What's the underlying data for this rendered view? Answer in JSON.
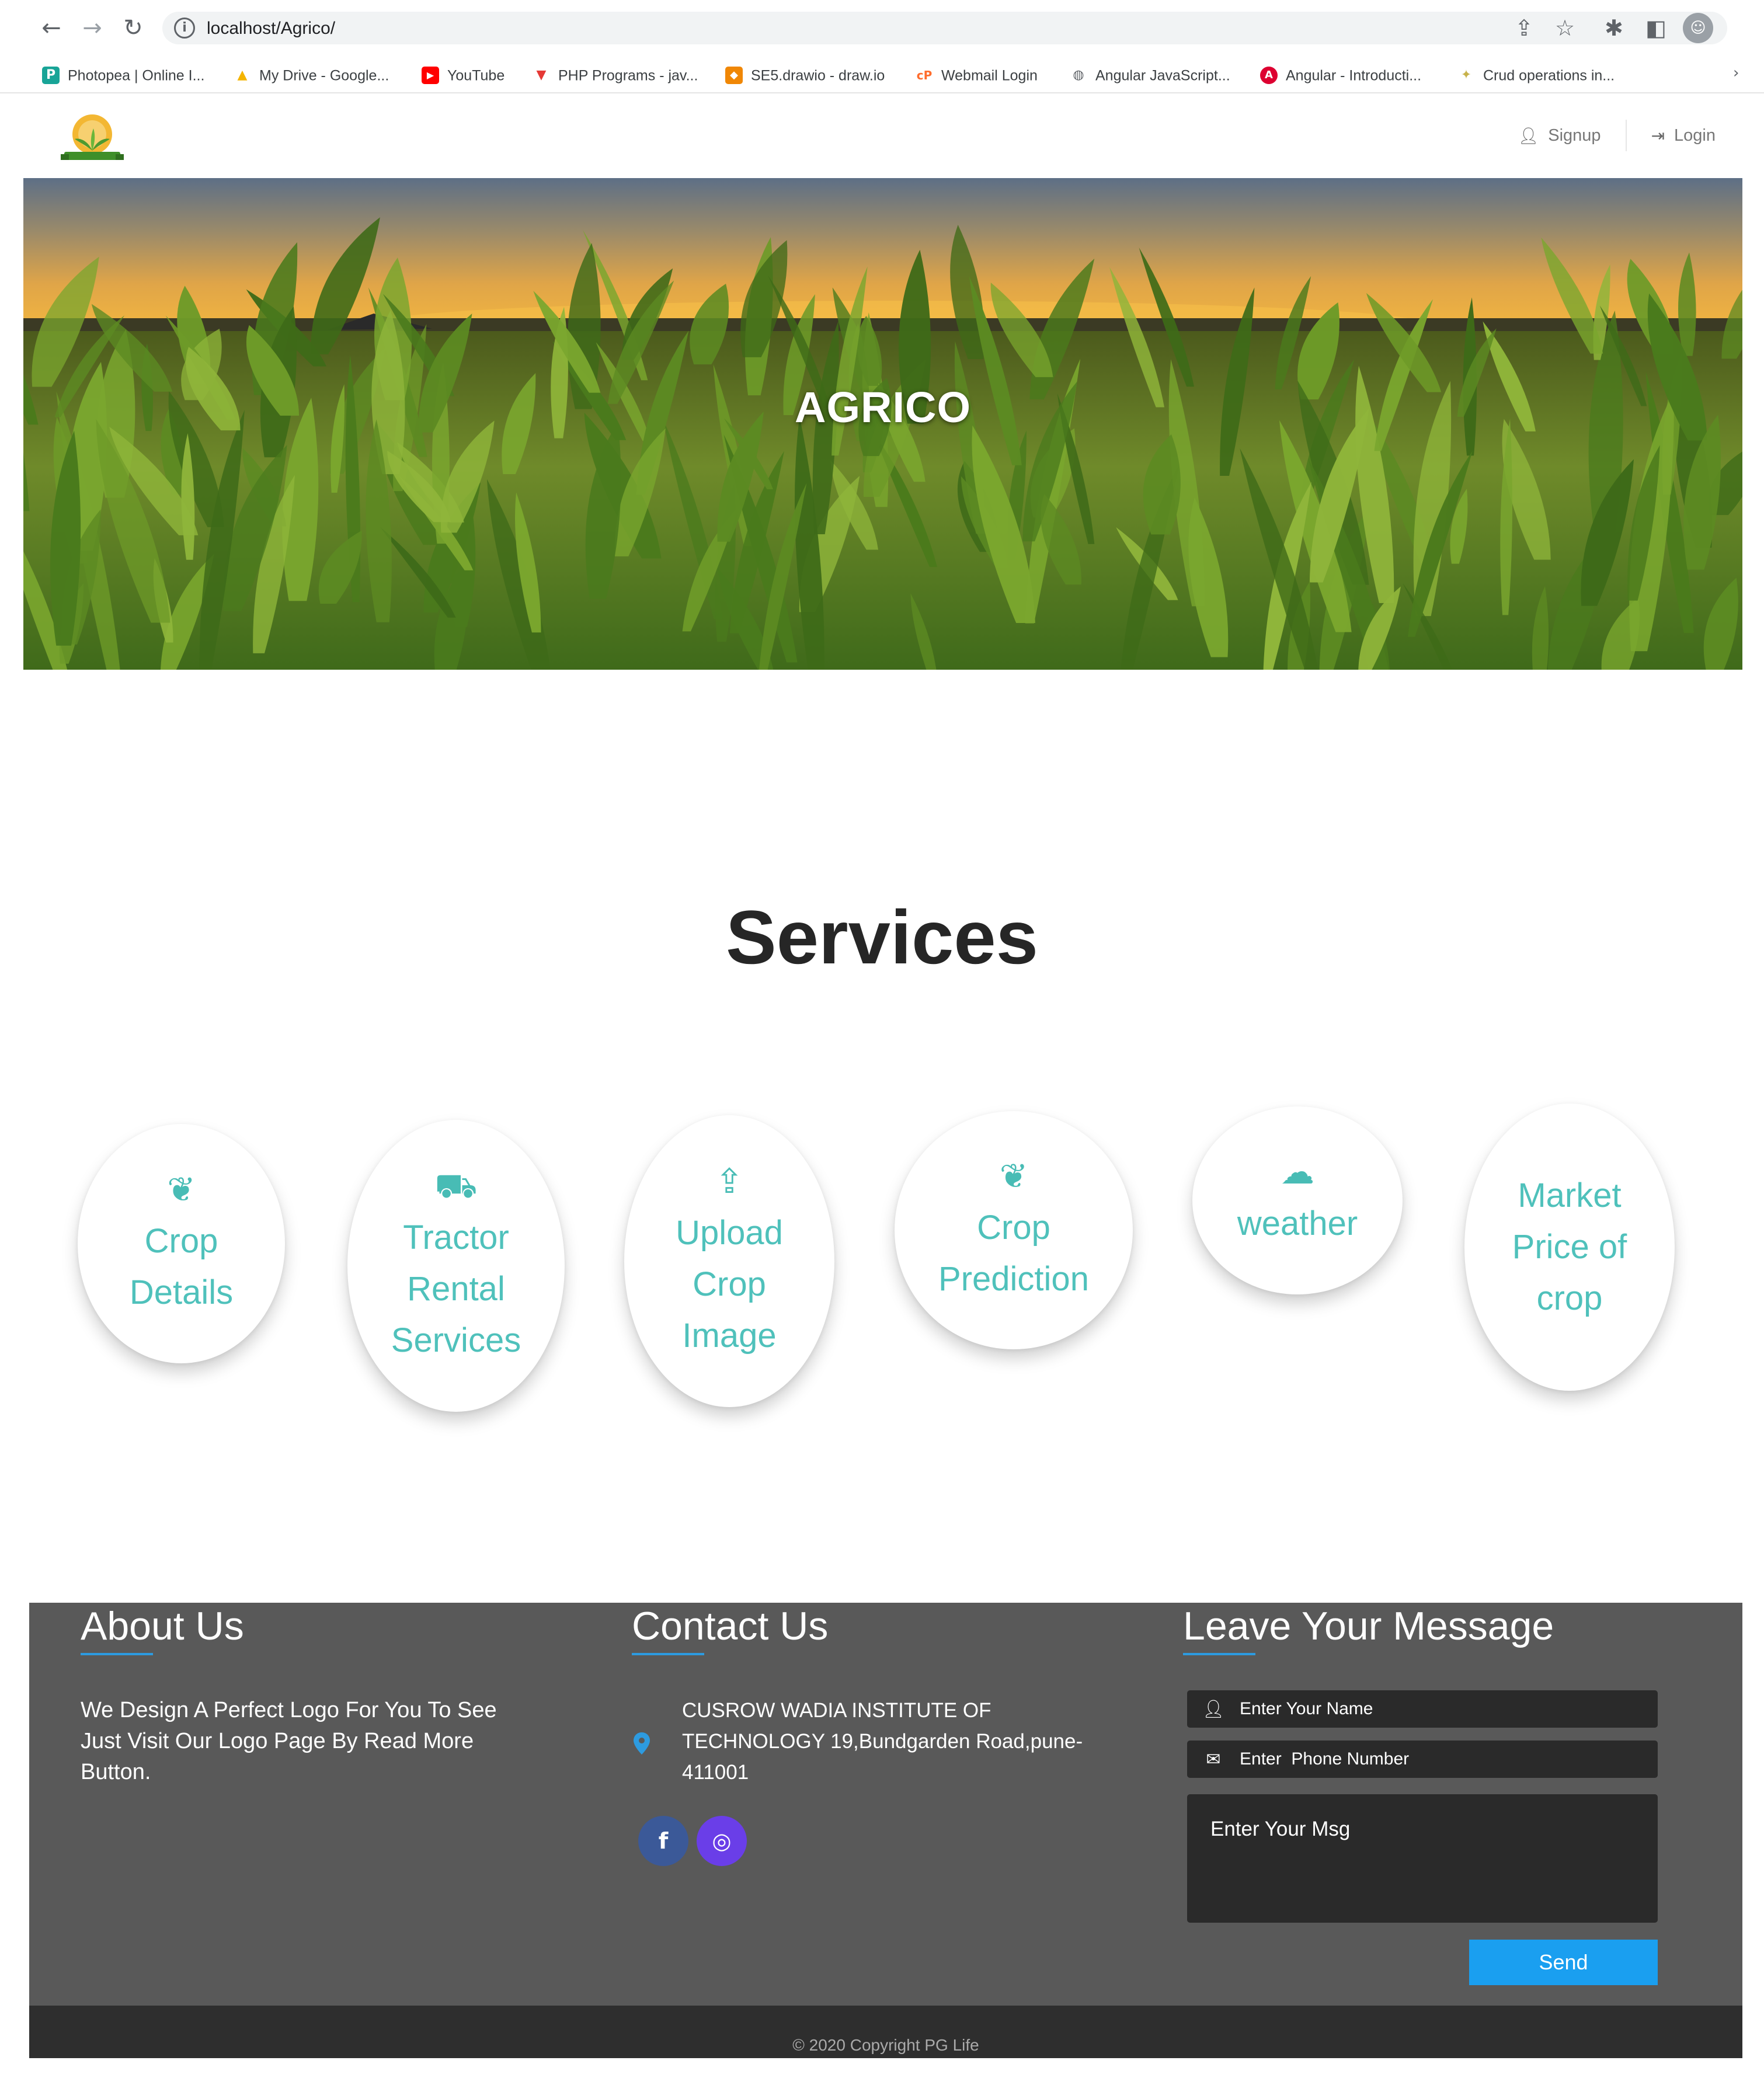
{
  "browser": {
    "url": "localhost/Agrico/",
    "bookmarks": [
      {
        "label": "Photopea | Online I...",
        "color": "#18a497",
        "glyph": "P"
      },
      {
        "label": "My Drive - Google...",
        "color": "#f4b400",
        "glyph": "▲"
      },
      {
        "label": "YouTube",
        "color": "#ff0000",
        "glyph": "▶"
      },
      {
        "label": "PHP Programs - jav...",
        "color": "#e53935",
        "glyph": "▼"
      },
      {
        "label": "SE5.drawio - draw.io",
        "color": "#f08705",
        "glyph": "◆"
      },
      {
        "label": "Webmail Login",
        "color": "#ff6c2c",
        "glyph": "cP"
      },
      {
        "label": "Angular JavaScript...",
        "color": "#5f6368",
        "glyph": "◍"
      },
      {
        "label": "Angular - Introducti...",
        "color": "#dd0031",
        "glyph": "A"
      },
      {
        "label": "Crud operations in...",
        "color": "#c7b24a",
        "glyph": "✦"
      }
    ]
  },
  "header": {
    "signup_label": "Signup",
    "login_label": "Login"
  },
  "hero": {
    "title": "AGRICO"
  },
  "services": {
    "title": "Services",
    "items": [
      {
        "label": "Crop Details",
        "icon": "sprout-icon",
        "glyph": "❦"
      },
      {
        "label": "Tractor Rental Services",
        "icon": "tractor-icon",
        "glyph": "⛟"
      },
      {
        "label": "Upload Crop Image",
        "icon": "upload-icon",
        "glyph": "⇪"
      },
      {
        "label": "Crop Prediction",
        "icon": "sprout-icon",
        "glyph": "❦"
      },
      {
        "label": "weather",
        "icon": "cloud-icon",
        "glyph": "☁"
      },
      {
        "label": "Market Price of crop",
        "icon": "",
        "glyph": ""
      }
    ]
  },
  "footer": {
    "about_title": "About Us",
    "about_text": "We Design A Perfect Logo For You To See Just Visit Our Logo Page By Read More Button.",
    "contact_title": "Contact Us",
    "contact_address": "CUSROW WADIA INSTITUTE OF TECHNOLOGY 19,Bundgarden Road,pune-411001",
    "message_title": "Leave Your Message",
    "name_placeholder": "Enter Your Name",
    "phone_placeholder": "Enter  Phone Number",
    "msg_placeholder": "Enter Your Msg",
    "send_label": "Send",
    "copyright": "© 2020 Copyright PG Life"
  },
  "colors": {
    "accent_teal": "#4fc1bb",
    "footer_bg": "#595959",
    "button_blue": "#1a9ff0",
    "underline_blue": "#2d9be0"
  }
}
